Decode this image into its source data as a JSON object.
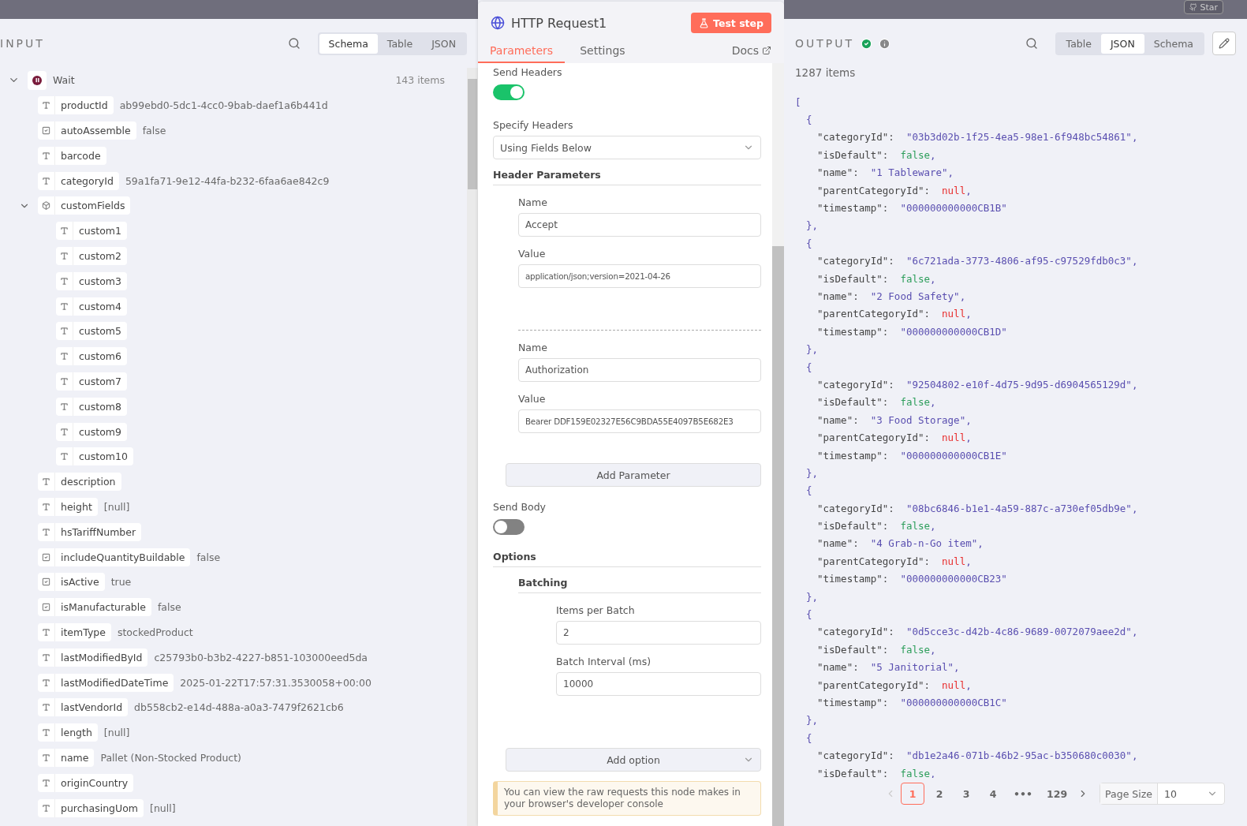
{
  "top_bar": {
    "star_button": "Star"
  },
  "input": {
    "title": "INPUT",
    "view_tabs": [
      {
        "label": "Schema",
        "selected": true
      },
      {
        "label": "Table",
        "selected": false
      },
      {
        "label": "JSON",
        "selected": false
      }
    ],
    "root": {
      "name": "Wait",
      "count": "143 items",
      "expanded": true
    },
    "fields": [
      {
        "kind": "string",
        "name": "productId",
        "value": "ab99ebd0-5dc1-4cc0-9bab-daef1a6b441d"
      },
      {
        "kind": "boolean",
        "name": "autoAssemble",
        "value": "false"
      },
      {
        "kind": "string",
        "name": "barcode"
      },
      {
        "kind": "string",
        "name": "categoryId",
        "value": "59a1fa71-9e12-44fa-b232-6faa6ae842c9"
      },
      {
        "kind": "object",
        "name": "customFields",
        "expanded": true,
        "children": [
          {
            "kind": "string",
            "name": "custom1"
          },
          {
            "kind": "string",
            "name": "custom2"
          },
          {
            "kind": "string",
            "name": "custom3"
          },
          {
            "kind": "string",
            "name": "custom4"
          },
          {
            "kind": "string",
            "name": "custom5"
          },
          {
            "kind": "string",
            "name": "custom6"
          },
          {
            "kind": "string",
            "name": "custom7"
          },
          {
            "kind": "string",
            "name": "custom8"
          },
          {
            "kind": "string",
            "name": "custom9"
          },
          {
            "kind": "string",
            "name": "custom10"
          }
        ]
      },
      {
        "kind": "string",
        "name": "description"
      },
      {
        "kind": "string",
        "name": "height",
        "value": "[null]"
      },
      {
        "kind": "string",
        "name": "hsTariffNumber"
      },
      {
        "kind": "boolean",
        "name": "includeQuantityBuildable",
        "value": "false"
      },
      {
        "kind": "boolean",
        "name": "isActive",
        "value": "true"
      },
      {
        "kind": "boolean",
        "name": "isManufacturable",
        "value": "false"
      },
      {
        "kind": "string",
        "name": "itemType",
        "value": "stockedProduct"
      },
      {
        "kind": "string",
        "name": "lastModifiedById",
        "value": "c25793b0-b3b2-4227-b851-103000eed5da"
      },
      {
        "kind": "string",
        "name": "lastModifiedDateTime",
        "value": "2025-01-22T17:57:31.3530058+00:00"
      },
      {
        "kind": "string",
        "name": "lastVendorId",
        "value": "db558cb2-e14d-488a-a0a3-7479f2621cb6"
      },
      {
        "kind": "string",
        "name": "length",
        "value": "[null]"
      },
      {
        "kind": "string",
        "name": "name",
        "value": "Pallet (Non-Stocked Product)"
      },
      {
        "kind": "string",
        "name": "originCountry"
      },
      {
        "kind": "string",
        "name": "purchasingUom",
        "value": "[null]"
      }
    ]
  },
  "node": {
    "title": "HTTP Request1",
    "test_button": "Test step",
    "tabs": [
      {
        "label": "Parameters",
        "selected": true
      },
      {
        "label": "Settings",
        "selected": false
      }
    ],
    "docs_link": "Docs",
    "send_headers": {
      "label": "Send Headers",
      "on": true
    },
    "specify_headers": {
      "label": "Specify Headers",
      "value": "Using Fields Below"
    },
    "header_parameters": {
      "title": "Header Parameters",
      "items": [
        {
          "name_label": "Name",
          "name": "Accept",
          "value_label": "Value",
          "value": "application/json;version=2021-04-26"
        },
        {
          "name_label": "Name",
          "name": "Authorization",
          "value_label": "Value",
          "value": "Bearer DDF159E02327E56C9BDA55E4097B5E682E3"
        }
      ]
    },
    "add_parameter": "Add Parameter",
    "send_body": {
      "label": "Send Body",
      "on": false
    },
    "options": {
      "title": "Options",
      "batching": {
        "title": "Batching",
        "fields": [
          {
            "label": "Items per Batch",
            "value": "2"
          },
          {
            "label": "Batch Interval (ms)",
            "value": "10000"
          }
        ]
      },
      "add_option": "Add option"
    },
    "notice": "You can view the raw requests this node makes in your browser's developer console"
  },
  "output": {
    "title": "OUTPUT",
    "success": true,
    "view_tabs": [
      {
        "label": "Table",
        "selected": false
      },
      {
        "label": "JSON",
        "selected": true
      },
      {
        "label": "Schema",
        "selected": false
      }
    ],
    "count": "1287 items",
    "json_view": {
      "open": "[",
      "records": [
        {
          "open": "{",
          "close": "},",
          "properties": [
            {
              "key": "\"categoryId\":",
              "kind": "string",
              "value": "\"03b3d02b-1f25-4ea5-98e1-6f948bc54861\"",
              "comma": ","
            },
            {
              "key": "\"isDefault\":",
              "kind": "boolean",
              "value": "false",
              "comma": ","
            },
            {
              "key": "\"name\":",
              "kind": "string",
              "value": "\"1 Tableware\"",
              "comma": ","
            },
            {
              "key": "\"parentCategoryId\":",
              "kind": "null",
              "value": "null",
              "comma": ","
            },
            {
              "key": "\"timestamp\":",
              "kind": "string",
              "value": "\"000000000000CB1B\""
            }
          ]
        },
        {
          "open": "{",
          "close": "},",
          "properties": [
            {
              "key": "\"categoryId\":",
              "kind": "string",
              "value": "\"6c721ada-3773-4806-af95-c97529fdb0c3\"",
              "comma": ","
            },
            {
              "key": "\"isDefault\":",
              "kind": "boolean",
              "value": "false",
              "comma": ","
            },
            {
              "key": "\"name\":",
              "kind": "string",
              "value": "\"2 Food Safety\"",
              "comma": ","
            },
            {
              "key": "\"parentCategoryId\":",
              "kind": "null",
              "value": "null",
              "comma": ","
            },
            {
              "key": "\"timestamp\":",
              "kind": "string",
              "value": "\"000000000000CB1D\""
            }
          ]
        },
        {
          "open": "{",
          "close": "},",
          "properties": [
            {
              "key": "\"categoryId\":",
              "kind": "string",
              "value": "\"92504802-e10f-4d75-9d95-d6904565129d\"",
              "comma": ","
            },
            {
              "key": "\"isDefault\":",
              "kind": "boolean",
              "value": "false",
              "comma": ","
            },
            {
              "key": "\"name\":",
              "kind": "string",
              "value": "\"3 Food Storage\"",
              "comma": ","
            },
            {
              "key": "\"parentCategoryId\":",
              "kind": "null",
              "value": "null",
              "comma": ","
            },
            {
              "key": "\"timestamp\":",
              "kind": "string",
              "value": "\"000000000000CB1E\""
            }
          ]
        },
        {
          "open": "{",
          "close": "},",
          "properties": [
            {
              "key": "\"categoryId\":",
              "kind": "string",
              "value": "\"08bc6846-b1e1-4a59-887c-a730ef05db9e\"",
              "comma": ","
            },
            {
              "key": "\"isDefault\":",
              "kind": "boolean",
              "value": "false",
              "comma": ","
            },
            {
              "key": "\"name\":",
              "kind": "string",
              "value": "\"4 Grab-n-Go item\"",
              "comma": ","
            },
            {
              "key": "\"parentCategoryId\":",
              "kind": "null",
              "value": "null",
              "comma": ","
            },
            {
              "key": "\"timestamp\":",
              "kind": "string",
              "value": "\"000000000000CB23\""
            }
          ]
        },
        {
          "open": "{",
          "close": "},",
          "properties": [
            {
              "key": "\"categoryId\":",
              "kind": "string",
              "value": "\"0d5cce3c-d42b-4c86-9689-0072079aee2d\"",
              "comma": ","
            },
            {
              "key": "\"isDefault\":",
              "kind": "boolean",
              "value": "false",
              "comma": ","
            },
            {
              "key": "\"name\":",
              "kind": "string",
              "value": "\"5 Janitorial\"",
              "comma": ","
            },
            {
              "key": "\"parentCategoryId\":",
              "kind": "null",
              "value": "null",
              "comma": ","
            },
            {
              "key": "\"timestamp\":",
              "kind": "string",
              "value": "\"000000000000CB1C\""
            }
          ]
        },
        {
          "open": "{",
          "properties": [
            {
              "key": "\"categoryId\":",
              "kind": "string",
              "value": "\"db1e2a46-071b-46b2-95ac-b350680c0030\"",
              "comma": ","
            },
            {
              "key": "\"isDefault\":",
              "kind": "boolean",
              "value": "false",
              "comma": ","
            }
          ]
        }
      ]
    },
    "pagination": {
      "pages": [
        {
          "label": "1",
          "selected": true
        },
        {
          "label": "2",
          "selected": false
        },
        {
          "label": "3",
          "selected": false
        },
        {
          "label": "4",
          "selected": false
        },
        {
          "label": "•••",
          "selected": false
        },
        {
          "label": "129",
          "selected": false
        }
      ],
      "page_size_label": "Page Size",
      "page_size": "10"
    }
  }
}
